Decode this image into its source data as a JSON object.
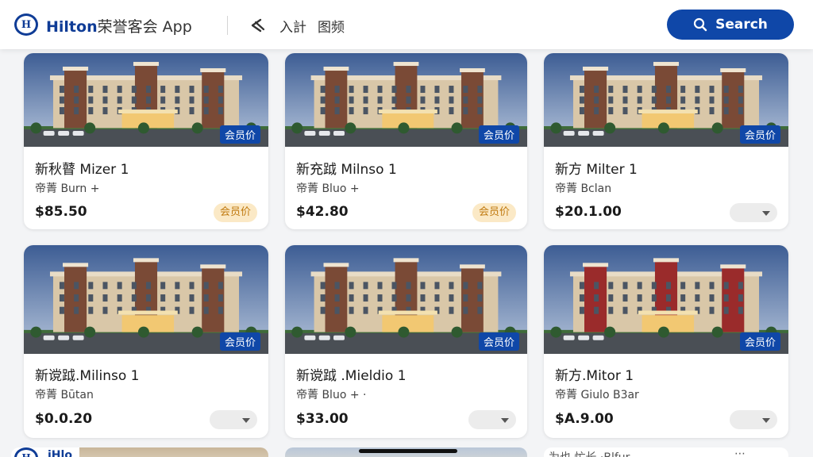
{
  "header": {
    "brand_en": "Hilton",
    "brand_cn": "荣誉客会 App",
    "nav_a": "入計",
    "nav_b": "图频",
    "search_label": "Search"
  },
  "colors": {
    "brand_blue": "#0f47a8",
    "gold_badge_bg": "#fbe9c6",
    "gold_badge_text": "#c07a10"
  },
  "member_tag": "会员价",
  "cards": [
    {
      "name": "新秋瞽 Mizer 1",
      "sub": "帝菁 Burn +",
      "price": "$85.50",
      "badge": "会员价"
    },
    {
      "name": "新充䟠 Milnso 1",
      "sub": "帝菁 Bluo +",
      "price": "$42.80",
      "badge": "会员价"
    },
    {
      "name": "新方 Milter 1",
      "sub": "帝菁 Bclan",
      "price": "$20.1.00",
      "badge": ""
    },
    {
      "name": "新谠䟠.Milinso 1",
      "sub": "帝菁 Būtan",
      "price": "$0.0.20",
      "badge": ""
    },
    {
      "name": "新谠䟠 .Mieldio 1",
      "sub": "帝菁 Bluo + ·",
      "price": "$33.00",
      "badge": ""
    },
    {
      "name": "新方.Mitor 1",
      "sub": "帝菁 Giulo B3ar",
      "price": "$A.9.00",
      "badge": ""
    }
  ],
  "peek_row": {
    "left_text": "iHlo",
    "right_text": "为也 忙长 ·Blfur"
  }
}
